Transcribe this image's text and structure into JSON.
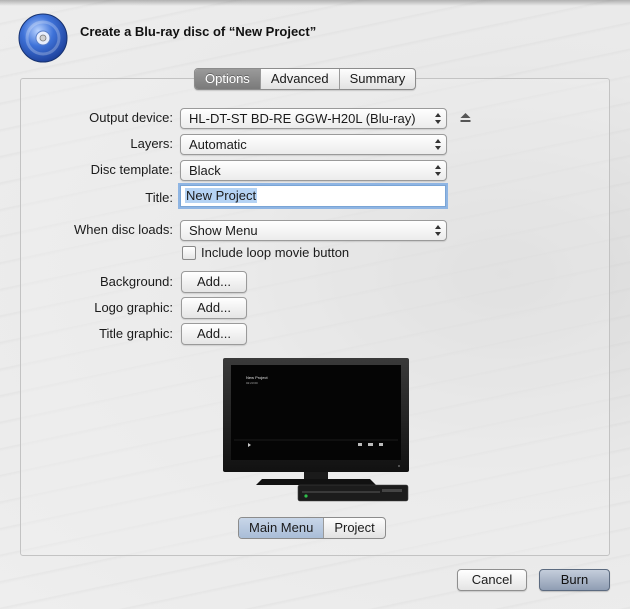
{
  "dialog": {
    "title": "Create a Blu-ray disc of “New Project”",
    "icon": "bluray-disc-icon"
  },
  "tabs": [
    {
      "label": "Options",
      "active": true
    },
    {
      "label": "Advanced",
      "active": false
    },
    {
      "label": "Summary",
      "active": false
    }
  ],
  "options": {
    "output_device": {
      "label": "Output device:",
      "value": "HL-DT-ST BD-RE  GGW-H20L (Blu-ray)"
    },
    "layers": {
      "label": "Layers:",
      "value": "Automatic"
    },
    "disc_template": {
      "label": "Disc template:",
      "value": "Black"
    },
    "title": {
      "label": "Title:",
      "value": "New Project"
    },
    "when_disc_loads": {
      "label": "When disc loads:",
      "value": "Show Menu"
    },
    "loop_movie": {
      "label": "Include loop movie button",
      "checked": false
    },
    "background": {
      "label": "Background:",
      "button": "Add..."
    },
    "logo_graphic": {
      "label": "Logo graphic:",
      "button": "Add..."
    },
    "title_graphic": {
      "label": "Title graphic:",
      "button": "Add..."
    }
  },
  "preview": {
    "menu_title": "New Project",
    "menu_time": "02:23:00"
  },
  "preview_segments": [
    {
      "label": "Main Menu",
      "active": true
    },
    {
      "label": "Project",
      "active": false
    }
  ],
  "buttons": {
    "cancel": "Cancel",
    "burn": "Burn"
  },
  "colors": {
    "accent": "#b5d3f4",
    "focus_ring": "#8fb5e3",
    "default_button": "#8f9db3"
  }
}
